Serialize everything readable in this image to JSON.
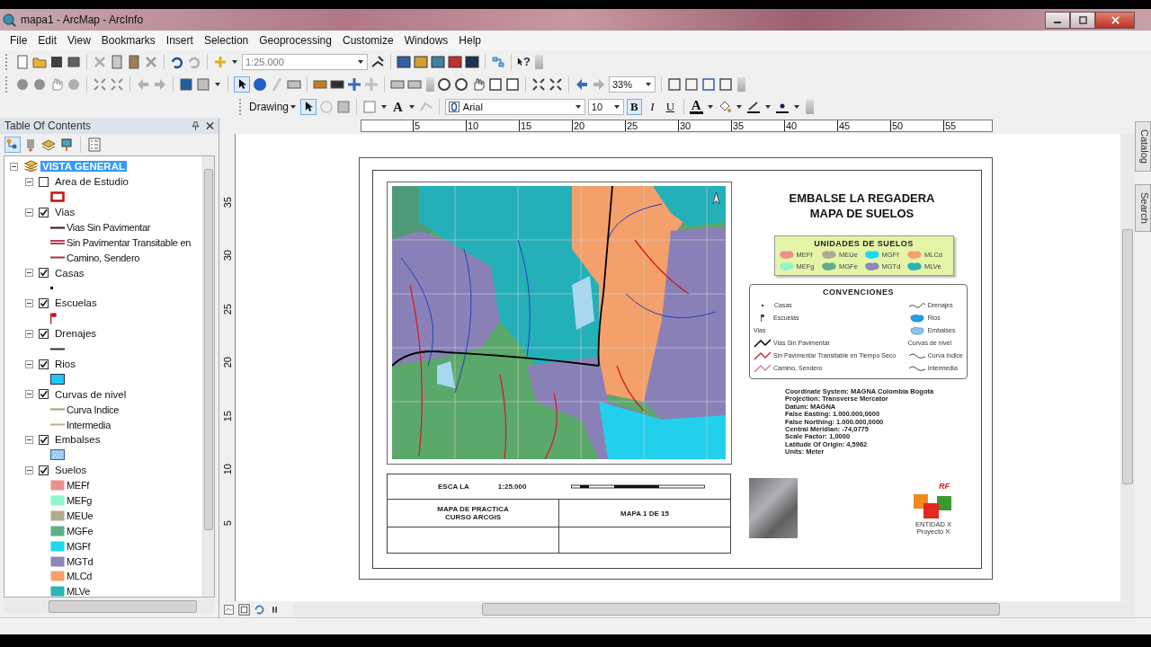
{
  "window": {
    "title": "mapa1 - ArcMap - ArcInfo"
  },
  "menu": [
    "File",
    "Edit",
    "View",
    "Bookmarks",
    "Insert",
    "Selection",
    "Geoprocessing",
    "Customize",
    "Windows",
    "Help"
  ],
  "toolbar": {
    "scale": "1:25.000",
    "help": "?",
    "layout_pointer": {
      "selected": true
    },
    "zoom": "33%",
    "drawing": "Drawing",
    "drawing_pointer": {
      "selected": true
    },
    "text_tool": "A",
    "font": "Arial",
    "font_size": "10",
    "font_color": "A",
    "styles": [
      {
        "label": "B",
        "selected": true
      },
      {
        "label": "I",
        "selected": false
      },
      {
        "label": "U",
        "selected": false
      }
    ]
  },
  "toc": {
    "title": "Table Of Contents",
    "frame": {
      "name": "VISTA GENERAL",
      "selected": true,
      "expanded": true,
      "children": [
        {
          "name": "Area de Estudio",
          "checked": false,
          "expanded": true,
          "legend": [
            {
              "kind": "outline",
              "color": "#cc1010"
            }
          ]
        },
        {
          "name": "Vias",
          "checked": true,
          "expanded": true,
          "legend": [
            {
              "kind": "line",
              "color": "#4a1010",
              "label": "Vias Sin Pavimentar"
            },
            {
              "kind": "double",
              "color": "#b04058",
              "label": "Sin Pavimentar Transitable en"
            },
            {
              "kind": "line",
              "color": "#a83040",
              "label": "Camino, Sendero"
            }
          ]
        },
        {
          "name": "Casas",
          "checked": true,
          "expanded": true,
          "legend": [
            {
              "kind": "point",
              "color": "#000000"
            }
          ]
        },
        {
          "name": "Escuelas",
          "checked": true,
          "expanded": true,
          "legend": [
            {
              "kind": "flag",
              "color": "#c01020"
            }
          ]
        },
        {
          "name": "Drenajes",
          "checked": true,
          "expanded": true,
          "legend": [
            {
              "kind": "line",
              "color": "#303030"
            }
          ]
        },
        {
          "name": "Rios",
          "checked": true,
          "expanded": true,
          "legend": [
            {
              "kind": "fill",
              "color": "#22c8f0"
            }
          ]
        },
        {
          "name": "Curvas de nivel",
          "checked": true,
          "expanded": true,
          "legend": [
            {
              "kind": "line",
              "color": "#a89878",
              "label": "Curva Indice"
            },
            {
              "kind": "line",
              "color": "#c0b090",
              "label": "Intermedia"
            }
          ]
        },
        {
          "name": "Embalses",
          "checked": true,
          "expanded": true,
          "legend": [
            {
              "kind": "hatch",
              "color": "#9cc8f0"
            }
          ]
        },
        {
          "name": "Suelos",
          "checked": true,
          "expanded": true,
          "legend": [
            {
              "kind": "fill",
              "color": "#ee8f8f",
              "label": "MEFf"
            },
            {
              "kind": "fill",
              "color": "#8ff5d0",
              "label": "MEFg"
            },
            {
              "kind": "fill",
              "color": "#b0ab8a",
              "label": "MEUe"
            },
            {
              "kind": "fill",
              "color": "#5fae8b",
              "label": "MGFe"
            },
            {
              "kind": "fill",
              "color": "#1cd9f0",
              "label": "MGFf"
            },
            {
              "kind": "fill",
              "color": "#8c86bb",
              "label": "MGTd"
            },
            {
              "kind": "fill",
              "color": "#f5a26a",
              "label": "MLCd"
            },
            {
              "kind": "fill",
              "color": "#2bb5b5",
              "label": "MLVe"
            }
          ]
        }
      ]
    }
  },
  "rulers": {
    "horizontal": [
      "5",
      "10",
      "15",
      "20",
      "25",
      "30",
      "35",
      "40",
      "45",
      "50",
      "55"
    ],
    "vertical": [
      "35",
      "30",
      "25",
      "20",
      "15",
      "10",
      "5"
    ]
  },
  "layout": {
    "title": [
      "EMBALSE LA REGADERA",
      "MAPA DE SUELOS"
    ],
    "units": {
      "title": "UNIDADES DE SUELOS",
      "items": [
        {
          "label": "MEFf",
          "color": "#ee8f8f"
        },
        {
          "label": "MEUe",
          "color": "#b0ab8a"
        },
        {
          "label": "MGFf",
          "color": "#1cd9f0"
        },
        {
          "label": "MLCd",
          "color": "#f5a26a"
        },
        {
          "label": "MEFg",
          "color": "#8ff5d0"
        },
        {
          "label": "MGFe",
          "color": "#5fae8b"
        },
        {
          "label": "MGTd",
          "color": "#8c86bb"
        },
        {
          "label": "MLVe",
          "color": "#2bb5b5"
        }
      ]
    },
    "conventions": {
      "title": "CONVENCIONES",
      "left": [
        {
          "kind": "point",
          "label": "Casas"
        },
        {
          "kind": "flag",
          "label": "Escuelas"
        },
        {
          "kind": "heading",
          "label": "Vias"
        },
        {
          "kind": "road",
          "color": "#000000",
          "label": "Vias Sin Pavimentar"
        },
        {
          "kind": "road",
          "color": "#c03040",
          "label": "Sin Pavimentar Transitable en Tiempo Seco"
        },
        {
          "kind": "road",
          "color": "#d08890",
          "label": "Camino, Sendero"
        }
      ],
      "right": [
        {
          "kind": "stream",
          "label": "Drenajes"
        },
        {
          "kind": "blob",
          "color": "#1fa0e8",
          "label": "Rios"
        },
        {
          "kind": "blob",
          "color": "#8cc4ec",
          "label": "Embalses"
        },
        {
          "kind": "heading",
          "label": "Curvas de nivel"
        },
        {
          "kind": "curve",
          "label": "Curva Indice"
        },
        {
          "kind": "curve",
          "label": "Intermedia"
        }
      ]
    },
    "projection": [
      "Coordinate System: MAGNA Colombia Bogota",
      "Projection: Transverse Mercator",
      "Datum: MAGNA",
      "False Easting: 1.000.000,0000",
      "False Northing: 1.000.000,0000",
      "Central Meridian: -74,0775",
      "Scale Factor: 1,0000",
      "Latitude Of Origin: 4,5962",
      "Units: Meter"
    ],
    "scale_table": {
      "scale_label": "ESCA LA",
      "scale": "1:25.000",
      "course": [
        "MAPA DE PRACTICA",
        "CURSO ARCGIS"
      ],
      "sheet": "MAPA 1 DE 15"
    },
    "logo": {
      "mark": "RF",
      "lines": [
        "ENTIDAD X",
        "Proyecto X"
      ]
    }
  },
  "side_tabs": [
    "Catalog",
    "Search"
  ]
}
